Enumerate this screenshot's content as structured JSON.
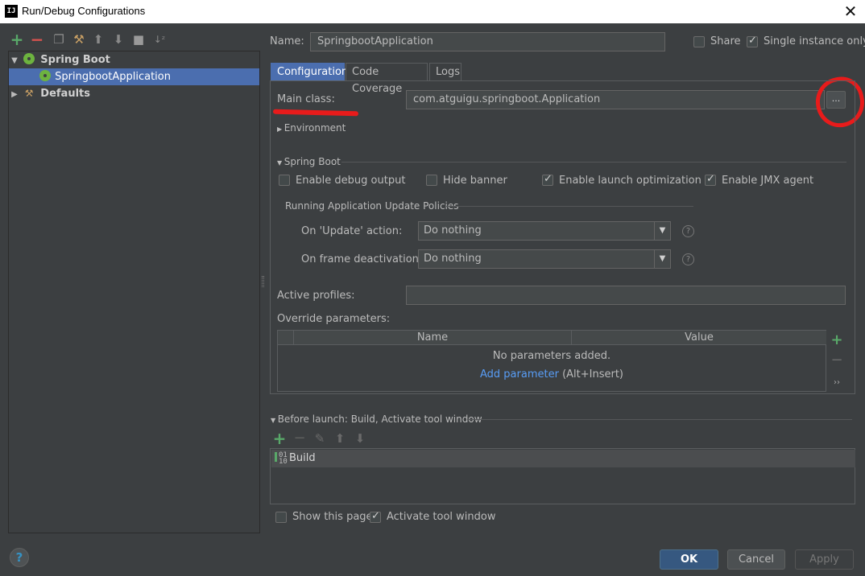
{
  "window": {
    "title": "Run/Debug Configurations",
    "close_glyph": "✕",
    "icon_text": "IJ"
  },
  "toolbar": {
    "items": [
      "add-icon",
      "remove-icon",
      "copy-icon",
      "wrench-icon",
      "arrow-up-icon",
      "arrow-down-icon",
      "folder-icon",
      "sort-icon"
    ]
  },
  "tree": {
    "spring_boot": "Spring Boot",
    "springboot_app": "SpringbootApplication",
    "defaults": "Defaults"
  },
  "header": {
    "name_label": "Name:",
    "name_value": "SpringbootApplication",
    "share_label": "Share",
    "single_instance_label": "Single instance only"
  },
  "tabs": [
    "Configuration",
    "Code Coverage",
    "Logs"
  ],
  "config": {
    "main_class_label": "Main class:",
    "main_class_value": "com.atguigu.springboot.Application",
    "browse_label": "...",
    "environment": "Environment",
    "spring_boot_section": "Spring Boot",
    "enable_debug": "Enable debug output",
    "hide_banner": "Hide banner",
    "enable_launch_opt": "Enable launch optimization",
    "enable_jmx": "Enable JMX agent",
    "policies_title": "Running Application Update Policies",
    "on_update_label": "On 'Update' action:",
    "on_update_value": "Do nothing",
    "on_frame_label": "On frame deactivation:",
    "on_frame_value": "Do nothing",
    "help_glyph": "?",
    "active_profiles_label": "Active profiles:",
    "active_profiles_value": "",
    "override_label": "Override parameters:",
    "col_name": "Name",
    "col_value": "Value",
    "empty_text": "No parameters added.",
    "add_param_link": "Add parameter",
    "add_param_hint": " (Alt+Insert)"
  },
  "before_launch": {
    "title": "Before launch: Build, Activate tool window",
    "build_item": "Build",
    "build_icon_text": "01\n10"
  },
  "footer": {
    "show_page": "Show this page",
    "activate_tool": "Activate tool window",
    "ok": "OK",
    "cancel": "Cancel",
    "apply": "Apply",
    "help": "?"
  },
  "colors": {
    "background": "#3c3f41",
    "selection": "#4b6eaf",
    "primary_button": "#365880",
    "annotation_red": "#e81b1b",
    "add_green": "#59a869",
    "remove_red": "#d9534f",
    "link_blue": "#589df6"
  }
}
